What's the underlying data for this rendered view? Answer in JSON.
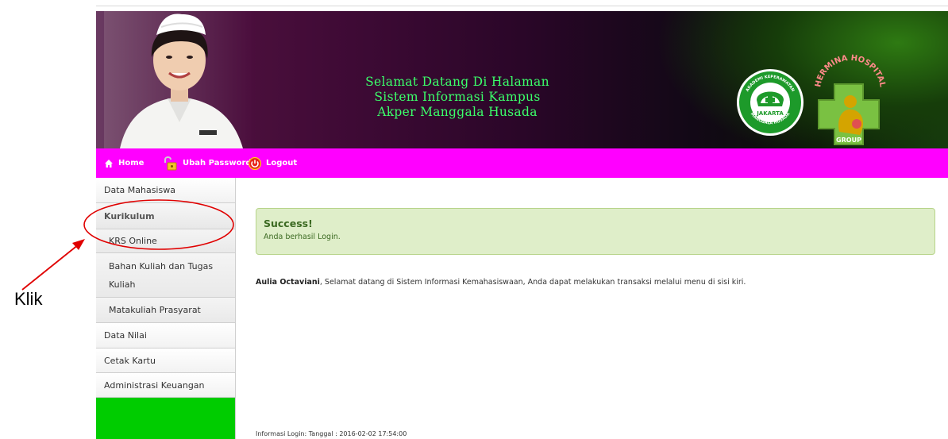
{
  "banner": {
    "title_lines": [
      "Selamat Datang Di Halaman",
      "Sistem Informasi Kampus",
      "Akper Manggala Husada"
    ],
    "logo_akper": {
      "ring_top_text": "AKADEMI KEPERAWATAN",
      "center_text": "JAKARTA",
      "ring_bottom_text": "MANGGALA HUSADA"
    },
    "logo_hermina": {
      "arc_text": "HERMINA HOSPITAL",
      "bottom_text": "GROUP"
    }
  },
  "nav": {
    "home": "Home",
    "change_password": "Ubah Password",
    "logout": "Logout"
  },
  "sidebar": {
    "items": [
      {
        "label": "Data Mahasiswa"
      },
      {
        "label": "Kurikulum"
      },
      {
        "label": "KRS Online"
      },
      {
        "label": "Bahan Kuliah dan Tugas Kuliah"
      },
      {
        "label": "Matakuliah Prasyarat"
      },
      {
        "label": "Data Nilai"
      },
      {
        "label": "Cetak Kartu"
      },
      {
        "label": "Administrasi Keuangan"
      }
    ]
  },
  "main": {
    "alert_title": "Success!",
    "alert_message": "Anda berhasil Login.",
    "welcome_name": "Aulia Octaviani",
    "welcome_text": ", Selamat datang di Sistem Informasi Kemahasiswaan, Anda dapat melakukan transaksi melalui menu di sisi kiri.",
    "login_info": "Informasi Login: Tanggal : 2016-02-02 17:54:00"
  },
  "annotation": {
    "label": "Klik"
  },
  "colors": {
    "nav_bg": "#ff00ff",
    "sidebar_bottom": "#00cc00",
    "banner_text": "#3bff6a",
    "alert_bg": "#dfeec9",
    "annotation": "#e00000"
  }
}
